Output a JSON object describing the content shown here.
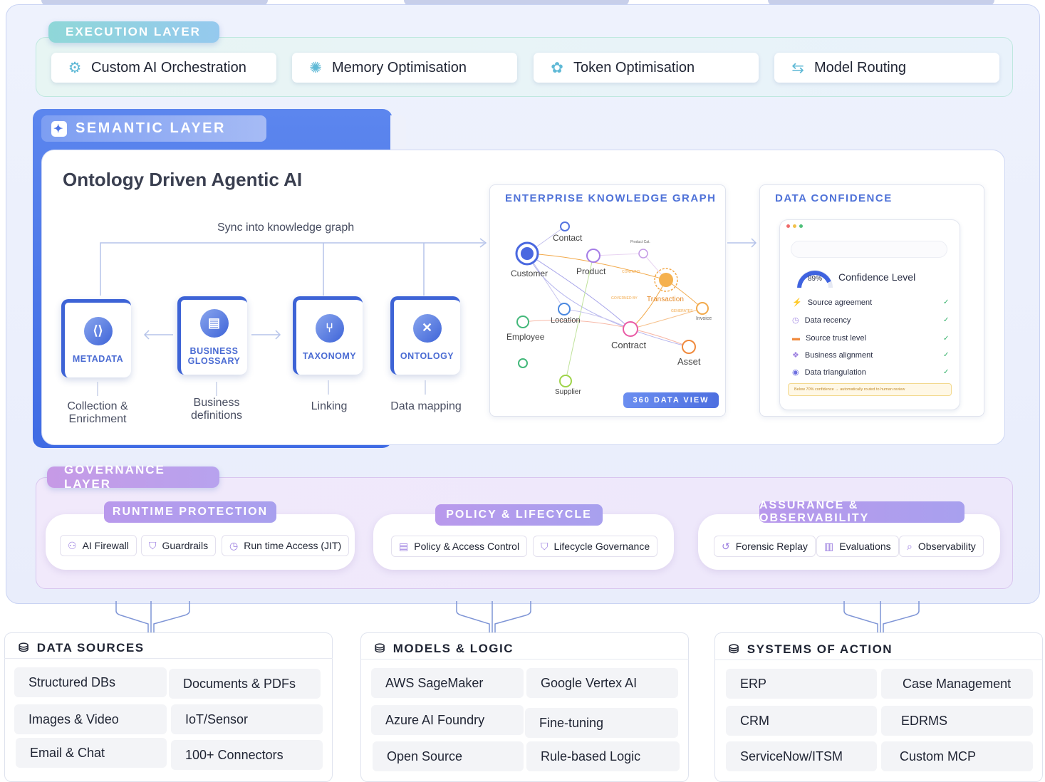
{
  "execution": {
    "title": "EXECUTION LAYER",
    "items": [
      {
        "label": "Custom AI Orchestration",
        "icon": "brain-chip-icon"
      },
      {
        "label": "Memory Optimisation",
        "icon": "neural-network-icon"
      },
      {
        "label": "Token Optimisation",
        "icon": "token-gear-icon"
      },
      {
        "label": "Model Routing",
        "icon": "routing-icon"
      }
    ]
  },
  "semantic": {
    "title": "SEMANTIC LAYER",
    "heading": "Ontology Driven Agentic AI",
    "sync_label": "Sync into knowledge graph",
    "tiles": [
      {
        "label": "METADATA",
        "caption": "Collection & Enrichment"
      },
      {
        "label": "BUSINESS GLOSSARY",
        "caption": "Business definitions"
      },
      {
        "label": "TAXONOMY",
        "caption": "Linking"
      },
      {
        "label": "ONTOLOGY",
        "caption": "Data mapping"
      }
    ],
    "knowledge_graph": {
      "title": "ENTERPRISE KNOWLEDGE GRAPH",
      "nodes": [
        "Contact",
        "Customer",
        "Product",
        "Product Cat.",
        "Transaction",
        "Location",
        "Invoice",
        "Employee",
        "Contract",
        "Asset",
        "Supplier"
      ],
      "edge_labels": [
        "CONTAINS",
        "GOVERNED BY",
        "GENERATES"
      ],
      "button": "360 DATA VIEW"
    },
    "data_confidence": {
      "title": "DATA CONFIDENCE",
      "gauge_value": "89%",
      "gauge_label": "Confidence Level",
      "checks": [
        "Source agreement",
        "Data recency",
        "Source trust level",
        "Business alignment",
        "Data triangulation"
      ],
      "check_mark": "✓",
      "note": "Below 70% confidence → automatically routed to human review"
    }
  },
  "governance": {
    "title": "GOVERNANCE LAYER",
    "groups": [
      {
        "title": "RUNTIME PROTECTION",
        "items": [
          "AI Firewall",
          "Guardrails",
          "Run time Access (JIT)"
        ]
      },
      {
        "title": "POLICY & LIFECYCLE",
        "items": [
          "Policy & Access Control",
          "Lifecycle Governance"
        ]
      },
      {
        "title": "ASSURANCE & OBSERVABILITY",
        "items": [
          "Forensic Replay",
          "Evaluations",
          "Observability"
        ]
      }
    ]
  },
  "bottom": [
    {
      "title": "DATA SOURCES",
      "cells": [
        "Structured DBs",
        "Documents & PDFs",
        "Images & Video",
        "IoT/Sensor",
        "Email & Chat",
        "100+ Connectors"
      ]
    },
    {
      "title": "MODELS & LOGIC",
      "cells": [
        "AWS SageMaker",
        "Google Vertex AI",
        "Azure AI Foundry",
        "Fine-tuning",
        "Open Source",
        "Rule-based Logic"
      ]
    },
    {
      "title": "SYSTEMS OF ACTION",
      "cells": [
        "ERP",
        "Case Management",
        "CRM",
        "EDRMS",
        "ServiceNow/ITSM",
        "Custom MCP"
      ]
    }
  ],
  "colors": {
    "accent_blue": "#3f6be4",
    "teal": "#8fd7d8",
    "purple": "#b999ec"
  }
}
